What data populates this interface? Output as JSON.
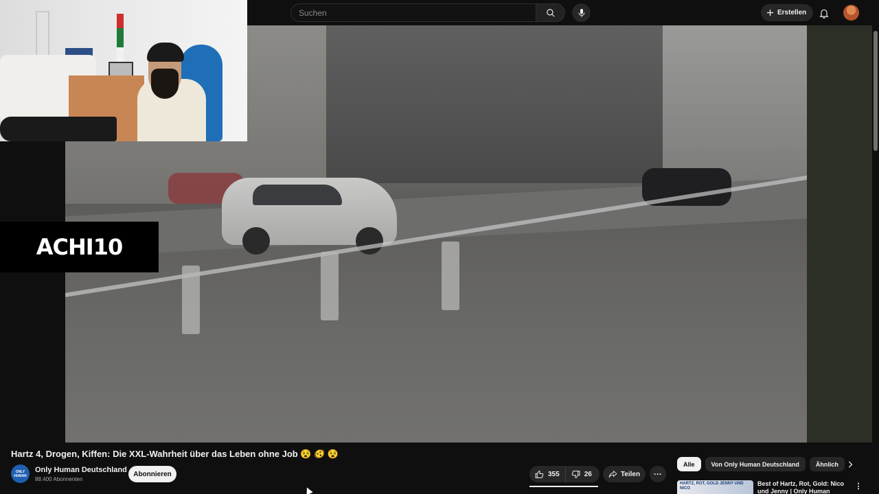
{
  "search": {
    "placeholder": "Suchen"
  },
  "header": {
    "create_label": "Erstellen"
  },
  "overlay": {
    "brand_text": "ACHI10"
  },
  "video": {
    "title": "Hartz 4, Drogen, Kiffen: Die XXL-Wahrheit über das Leben ohne Job 😵 🫨 😵",
    "channel_name": "Only Human Deutschland",
    "channel_avatar_text": "ONLY HUMAN",
    "subscribers": "88.400 Abonnenten",
    "subscribe_label": "Abonnieren",
    "likes": "355",
    "dislikes": "26",
    "share_label": "Teilen"
  },
  "chips": [
    "Alle",
    "Von Only Human Deutschland",
    "Ähnlich"
  ],
  "recommendations": [
    {
      "thumb_text": "HARTZ, ROT, GOLD JENNY UND NICO",
      "title": "Best of Hartz, Rot, Gold: Nico und Jenny | Only Human"
    }
  ],
  "colors": {
    "background": "#0f0f0f",
    "chip_active": "#f1f1f1",
    "button_bg": "#272727"
  }
}
